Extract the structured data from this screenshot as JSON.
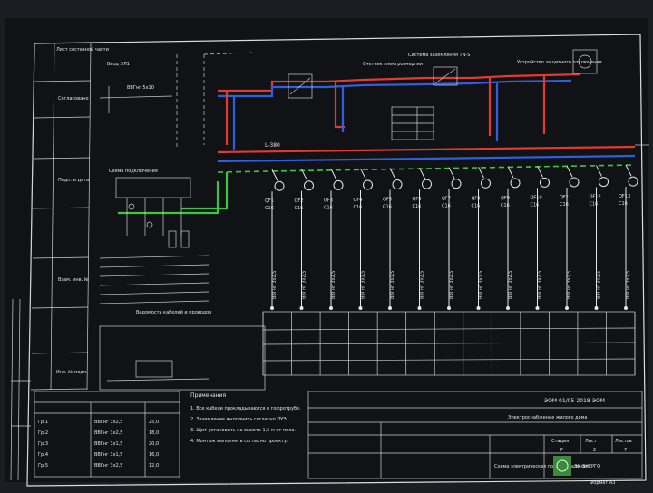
{
  "sheet": {
    "left_stamp_labels": [
      "Лист составной части",
      "Согласовано",
      "Подп. и дата",
      "Взам. инв. №",
      "Инв. № подл."
    ],
    "bus_label": "L-380",
    "feeder_count": 13,
    "feeder_labels": [
      "QF1",
      "QF2",
      "QF3",
      "QF4",
      "QF5",
      "QF6",
      "QF7",
      "QF8",
      "QF9",
      "QF10",
      "QF11",
      "QF12",
      "QF13"
    ],
    "feeder_ratings": [
      "C16",
      "C16",
      "C16",
      "C16",
      "C16",
      "C16",
      "C16",
      "C16",
      "C16",
      "C16",
      "C16",
      "C16",
      "C16"
    ],
    "feeder_cables": [
      "ВВГнг 3х2,5",
      "ВВГнг 3х2,5",
      "ВВГнг 3х2,5",
      "ВВГнг 3х1,5",
      "ВВГнг 3х1,5",
      "ВВГнг 3х2,5",
      "ВВГнг 3х2,5",
      "ВВГнг 3х1,5",
      "ВВГнг 3х2,5",
      "ВВГнг 3х2,5",
      "ВВГнг 3х1,5",
      "ВВГнг 3х2,5",
      "ВВГнг 3х2,5"
    ],
    "top_notes": [
      "Система заземления TN-S",
      "Счетчик электроэнергии",
      "Устройство защитного отключения"
    ],
    "legend_title": "Схема подключения",
    "spec_title": "Ведомость кабелей и проводов",
    "notes_title": "Примечания",
    "notes": [
      "1. Все кабели прокладываются в гофротрубе.",
      "2. Заземление выполнить согласно ПУЭ.",
      "3. Щит установить на высоте 1,5 м от пола.",
      "4. Монтаж выполнять согласно проекту."
    ],
    "title_block": {
      "code": "ЭОМ 01/05-2018-ЭОМ",
      "project": "Электроснабжение жилого дома",
      "stage": "Стадия",
      "sheet": "Лист",
      "sheets": "Листов",
      "stage_val": "Р",
      "sheet_val": "2",
      "sheets_val": "7",
      "drawing": "Схема электрическая принципиальная",
      "format": "Формат А3"
    },
    "cable_table": [
      [
        "Гр.1",
        "ВВГнг 3х2,5",
        "25,0"
      ],
      [
        "Гр.2",
        "ВВГнг 3х2,5",
        "18,0"
      ],
      [
        "Гр.3",
        "ВВГнг 3х1,5",
        "20,0"
      ],
      [
        "Гр.4",
        "ВВГнг 3х1,5",
        "16,0"
      ],
      [
        "Гр.5",
        "ВВГнг 3х2,5",
        "12,0"
      ]
    ],
    "logo_text": "ЭК ЭНЕРГО"
  }
}
